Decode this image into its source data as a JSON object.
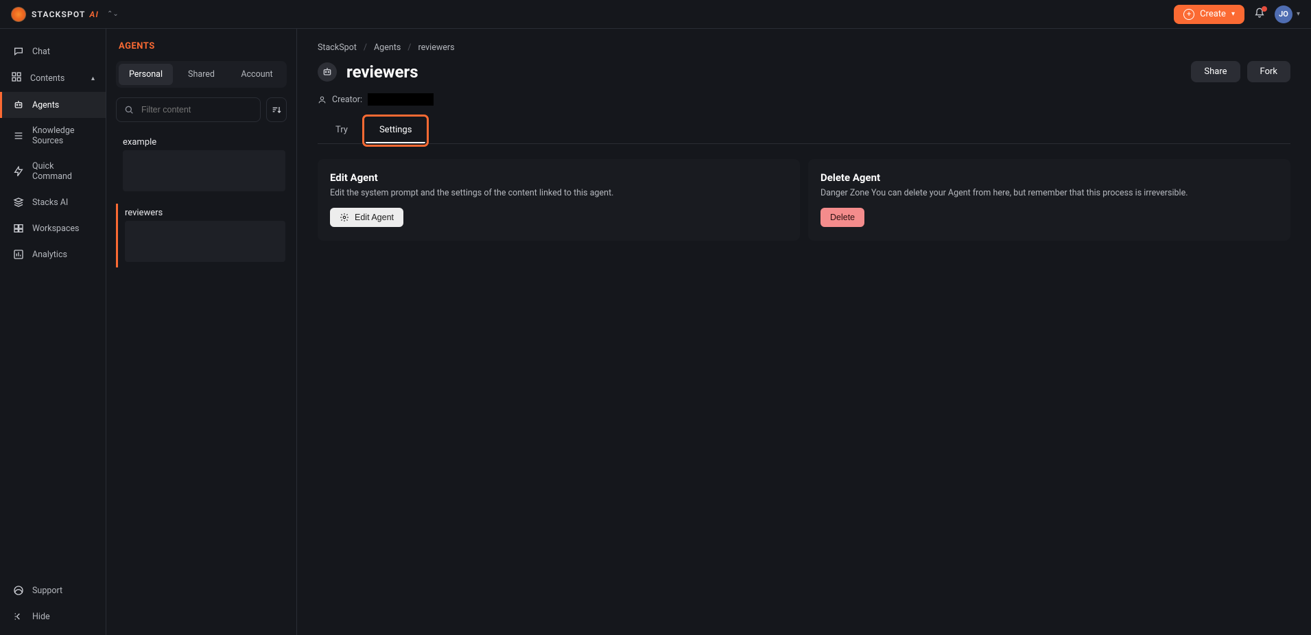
{
  "header": {
    "logo_text": "STACKSPOT",
    "logo_suffix": "AI",
    "create_label": "Create",
    "avatar_initials": "JO"
  },
  "nav": {
    "chat": "Chat",
    "contents_section": "Contents",
    "agents": "Agents",
    "knowledge_sources": "Knowledge Sources",
    "quick_command": "Quick Command",
    "stacks_ai": "Stacks AI",
    "workspaces": "Workspaces",
    "analytics": "Analytics",
    "support": "Support",
    "hide": "Hide"
  },
  "agents_panel": {
    "title": "AGENTS",
    "scope_tabs": {
      "personal": "Personal",
      "shared": "Shared",
      "account": "Account"
    },
    "filter_placeholder": "Filter content",
    "items": [
      {
        "label": "example"
      },
      {
        "label": "reviewers"
      }
    ]
  },
  "breadcrumb": {
    "root": "StackSpot",
    "mid": "Agents",
    "current": "reviewers"
  },
  "page": {
    "title": "reviewers",
    "share_label": "Share",
    "fork_label": "Fork",
    "creator_label": "Creator:",
    "tabs": {
      "try": "Try",
      "settings": "Settings"
    }
  },
  "cards": {
    "edit": {
      "title": "Edit Agent",
      "desc": "Edit the system prompt and the settings of the content linked to this agent.",
      "button": "Edit Agent"
    },
    "delete": {
      "title": "Delete Agent",
      "desc": "Danger Zone You can delete your Agent from here, but remember that this process is irreversible.",
      "button": "Delete"
    }
  }
}
